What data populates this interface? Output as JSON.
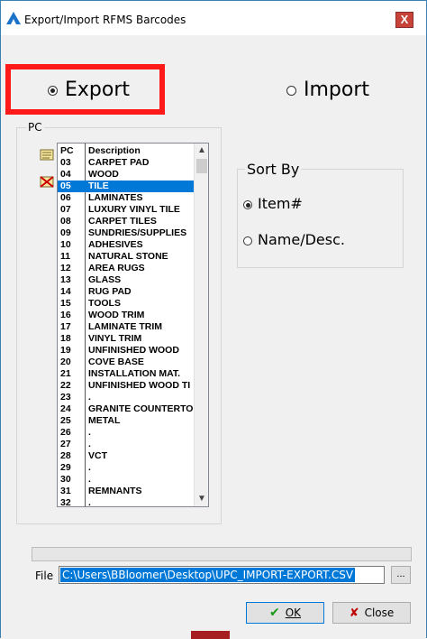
{
  "window": {
    "title": "Export/Import RFMS Barcodes",
    "close_symbol": "X"
  },
  "mode": {
    "export_label": "Export",
    "import_label": "Import",
    "selected": "export"
  },
  "pc_group": {
    "label": "PC",
    "columns": {
      "pc": "PC",
      "description": "Description"
    },
    "items": [
      {
        "pc": "03",
        "desc": "CARPET PAD"
      },
      {
        "pc": "04",
        "desc": "WOOD"
      },
      {
        "pc": "05",
        "desc": "TILE"
      },
      {
        "pc": "06",
        "desc": "LAMINATES"
      },
      {
        "pc": "07",
        "desc": "LUXURY VINYL TILE"
      },
      {
        "pc": "08",
        "desc": "CARPET TILES"
      },
      {
        "pc": "09",
        "desc": "SUNDRIES/SUPPLIES"
      },
      {
        "pc": "10",
        "desc": "ADHESIVES"
      },
      {
        "pc": "11",
        "desc": "NATURAL STONE"
      },
      {
        "pc": "12",
        "desc": "AREA RUGS"
      },
      {
        "pc": "13",
        "desc": "GLASS"
      },
      {
        "pc": "14",
        "desc": "RUG PAD"
      },
      {
        "pc": "15",
        "desc": "TOOLS"
      },
      {
        "pc": "16",
        "desc": "WOOD TRIM"
      },
      {
        "pc": "17",
        "desc": "LAMINATE TRIM"
      },
      {
        "pc": "18",
        "desc": "VINYL TRIM"
      },
      {
        "pc": "19",
        "desc": "UNFINISHED WOOD"
      },
      {
        "pc": "20",
        "desc": "COVE BASE"
      },
      {
        "pc": "21",
        "desc": "INSTALLATION MAT."
      },
      {
        "pc": "22",
        "desc": "UNFINISHED WOOD TI"
      },
      {
        "pc": "23",
        "desc": "."
      },
      {
        "pc": "24",
        "desc": "GRANITE COUNTERTO"
      },
      {
        "pc": "25",
        "desc": "METAL"
      },
      {
        "pc": "26",
        "desc": "."
      },
      {
        "pc": "27",
        "desc": "."
      },
      {
        "pc": "28",
        "desc": "VCT"
      },
      {
        "pc": "29",
        "desc": "."
      },
      {
        "pc": "30",
        "desc": "."
      },
      {
        "pc": "31",
        "desc": "REMNANTS"
      },
      {
        "pc": "32",
        "desc": "."
      }
    ],
    "selected_pc": "05"
  },
  "sort_by": {
    "label": "Sort By",
    "item_label": "Item#",
    "name_label": "Name/Desc.",
    "selected": "item"
  },
  "file": {
    "label": "File",
    "path": "C:\\Users\\BBloomer\\Desktop\\UPC_IMPORT-EXPORT.CSV",
    "browse_label": "..."
  },
  "buttons": {
    "ok_label": "OK",
    "close_label": "Close"
  },
  "colors": {
    "highlight": "#ff1a1a",
    "selection": "#0078d7"
  }
}
